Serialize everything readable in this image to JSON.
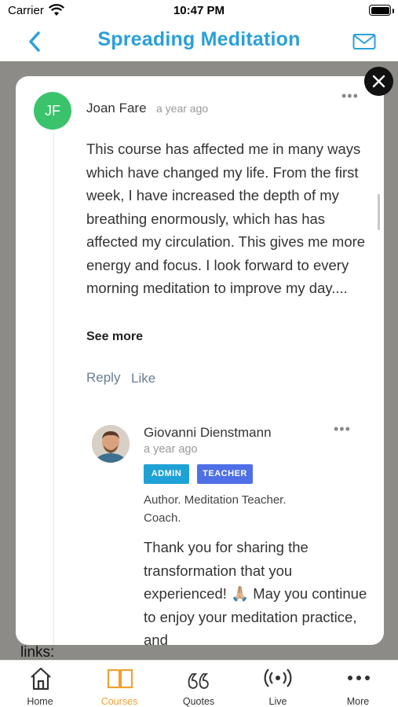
{
  "status_bar": {
    "carrier": "Carrier",
    "time": "10:47 PM"
  },
  "header": {
    "title": "Spreading Meditation",
    "back_icon": "chevron-left-icon",
    "mail_icon": "mail-icon"
  },
  "background": {
    "links_text": "links:"
  },
  "comment": {
    "avatar_initials": "JF",
    "avatar_color": "#3ac36b",
    "author": "Joan Fare",
    "time": "a year ago",
    "body": "This course has affected me in many ways which have changed my life. From the first week, I have increased the depth of my breathing enormously, which has has affected my circulation. This gives me more energy and focus. I look forward to every morning meditation to improve my day....",
    "see_more": "See more",
    "reply": "Reply",
    "like": "Like"
  },
  "reply": {
    "author": "Giovanni Dienstmann",
    "time": "a year ago",
    "badges": [
      "ADMIN",
      "TEACHER"
    ],
    "bio": "Author. Meditation Teacher. Coach.",
    "body": "Thank you for sharing the transformation that you experienced! 🙏🏼 May you continue to enjoy your meditation practice, and"
  },
  "tabs": [
    {
      "label": "Home",
      "icon": "home-icon",
      "active": false
    },
    {
      "label": "Courses",
      "icon": "book-icon",
      "active": true
    },
    {
      "label": "Quotes",
      "icon": "quote-icon",
      "active": false
    },
    {
      "label": "Live",
      "icon": "broadcast-icon",
      "active": false
    },
    {
      "label": "More",
      "icon": "more-icon",
      "active": false
    }
  ],
  "colors": {
    "accent": "#2aa0d8",
    "active_tab": "#f0a030",
    "admin_badge": "#1ea2d6",
    "teacher_badge": "#4f6fe6"
  }
}
